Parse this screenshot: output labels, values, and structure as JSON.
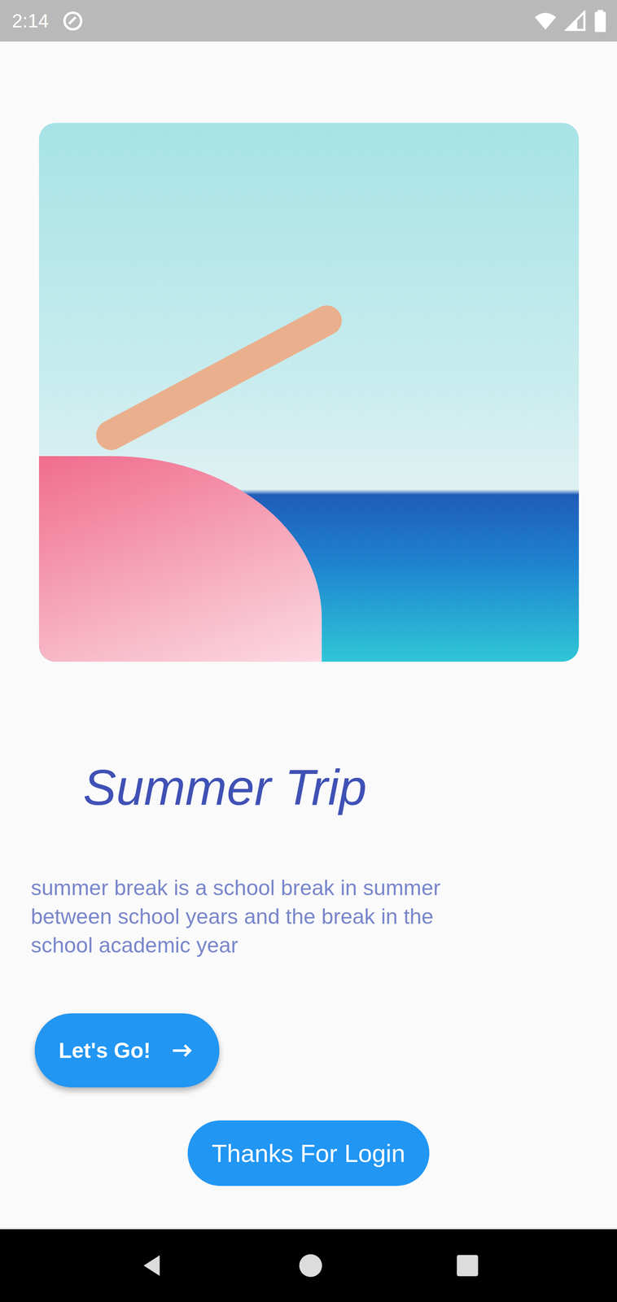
{
  "status_bar": {
    "time": "2:14"
  },
  "card": {
    "title": "Summer Trip",
    "description": "summer break is a school break in summer between school years and the break in the school academic year"
  },
  "buttons": [
    {
      "label": "Let's Go!",
      "kind": "extended"
    },
    {
      "label": "Thanks For Login",
      "kind": "plain"
    }
  ]
}
